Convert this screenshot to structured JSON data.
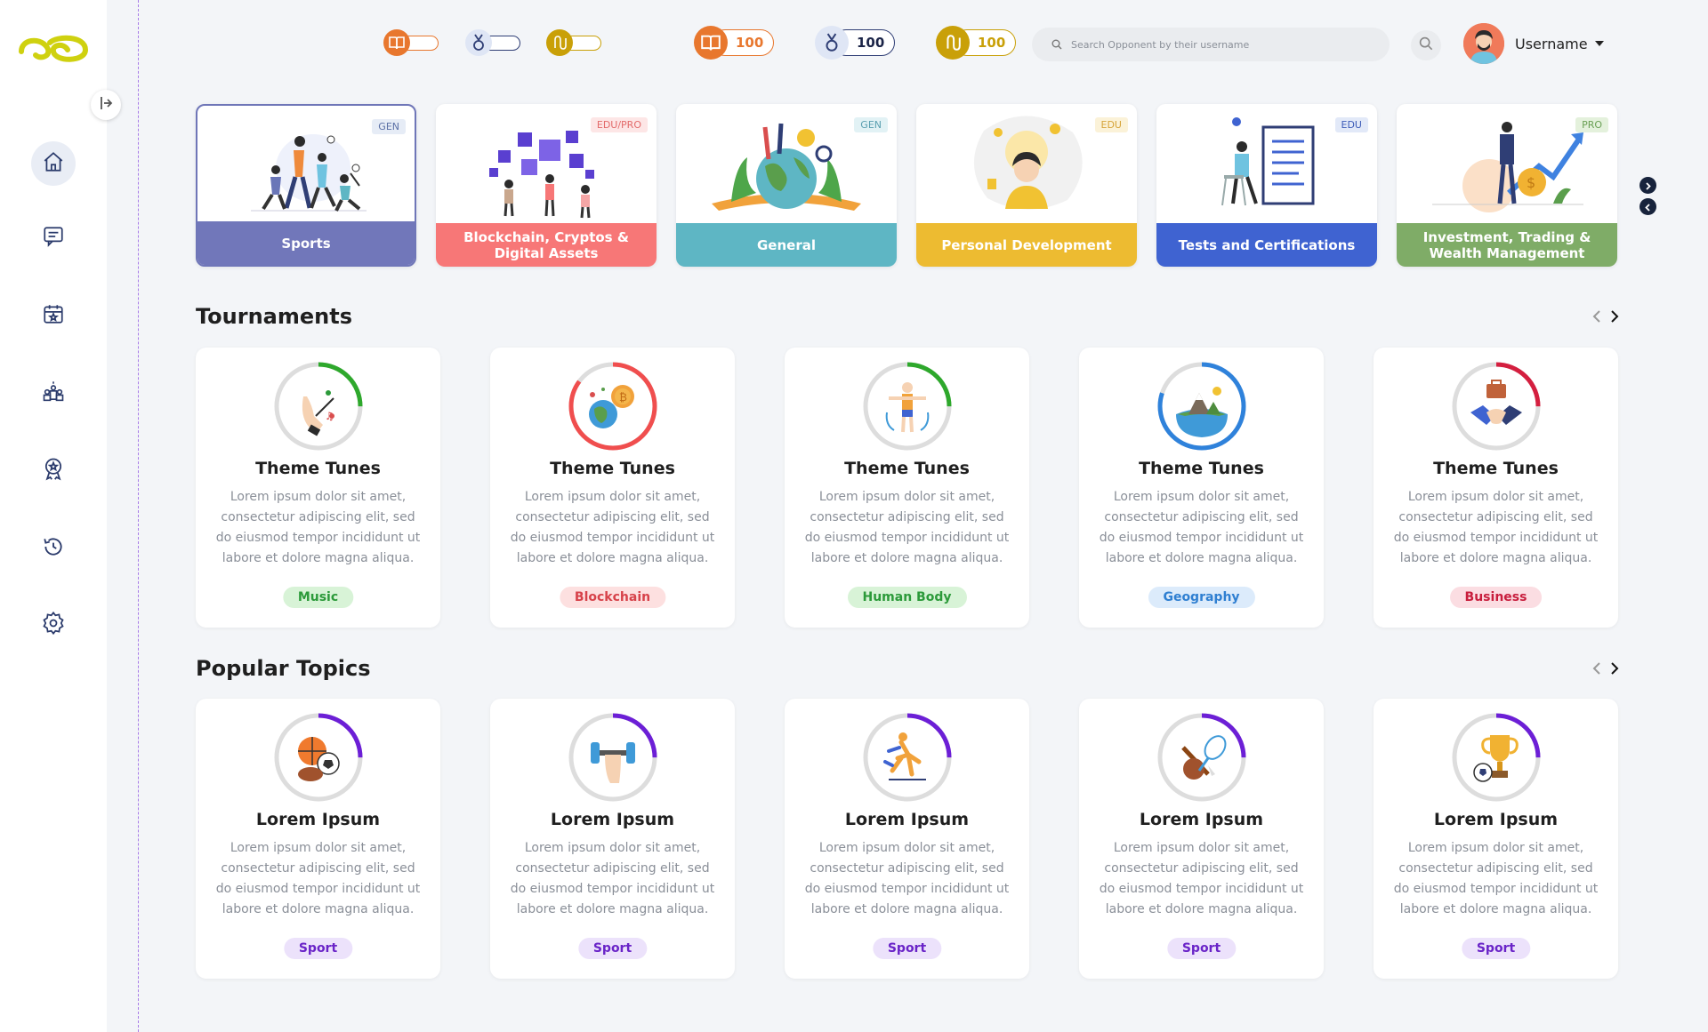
{
  "header": {
    "toggles": [
      {
        "icon": "book-icon",
        "color": "#e8772e"
      },
      {
        "icon": "medal-icon",
        "color": "#2f3e75"
      },
      {
        "icon": "coin-icon",
        "color": "#c9a008"
      }
    ],
    "counters": [
      {
        "icon": "book-icon",
        "value": "100",
        "color": "#e8772e"
      },
      {
        "icon": "medal-icon",
        "value": "100",
        "color": "#2f3e75"
      },
      {
        "icon": "coin-icon",
        "value": "100",
        "color": "#c9a008"
      }
    ],
    "search_placeholder": "Search Opponent by their username",
    "username": "Username"
  },
  "sidebar": {
    "items": [
      {
        "name": "home-icon",
        "active": true
      },
      {
        "name": "chat-icon",
        "active": false
      },
      {
        "name": "calendar-icon",
        "active": false
      },
      {
        "name": "team-icon",
        "active": false
      },
      {
        "name": "award-icon",
        "active": false
      },
      {
        "name": "history-icon",
        "active": false
      },
      {
        "name": "settings-icon",
        "active": false
      }
    ]
  },
  "categories": [
    {
      "label": "Sports",
      "tag": "GEN",
      "color": "#7177ba",
      "tag_color": "#5a6fa5",
      "tag_bg": "#e6ecf6"
    },
    {
      "label": "Blockchain, Cryptos & Digital Assets",
      "tag": "EDU/PRO",
      "color": "#f77777",
      "tag_color": "#e36b6b",
      "tag_bg": "#fde6e6"
    },
    {
      "label": "General",
      "tag": "GEN",
      "color": "#5eb6c4",
      "tag_color": "#5a9fb0",
      "tag_bg": "#e2f2f5"
    },
    {
      "label": "Personal Development",
      "tag": "EDU",
      "color": "#edbb31",
      "tag_color": "#d6a43a",
      "tag_bg": "#fbf2d8"
    },
    {
      "label": "Tests and Certifications",
      "tag": "EDU",
      "color": "#3f63d1",
      "tag_color": "#3d5cb8",
      "tag_bg": "#e2e9f8"
    },
    {
      "label": "Investment, Trading & Wealth Management",
      "tag": "PRO",
      "color": "#7fac67",
      "tag_color": "#6aa055",
      "tag_bg": "#e4f1dc"
    }
  ],
  "tournaments": {
    "title": "Tournaments",
    "cards": [
      {
        "title": "Theme Tunes",
        "desc": "Lorem ipsum dolor sit amet, consectetur adipiscing elit, sed do eiusmod tempor incididunt ut labore et dolore magna aliqua.",
        "badge": "Music",
        "badge_color": "#2c9a3a",
        "badge_bg": "#d8f3d7",
        "ring_color": "#2ea82c",
        "progress": 0.25,
        "icon": "music-hand-icon"
      },
      {
        "title": "Theme Tunes",
        "desc": "Lorem ipsum dolor sit amet, consectetur adipiscing elit, sed do eiusmod tempor incididunt ut labore et dolore magna aliqua.",
        "badge": "Blockchain",
        "badge_color": "#d7424a",
        "badge_bg": "#fde0e0",
        "ring_color": "#f04e4e",
        "progress": 0.85,
        "icon": "crypto-globe-icon"
      },
      {
        "title": "Theme Tunes",
        "desc": "Lorem ipsum dolor sit amet, consectetur adipiscing elit, sed do eiusmod tempor incididunt ut labore et dolore magna aliqua.",
        "badge": "Human Body",
        "badge_color": "#2c9a3a",
        "badge_bg": "#d8f3d7",
        "ring_color": "#2ea82c",
        "progress": 0.25,
        "icon": "human-body-icon"
      },
      {
        "title": "Theme Tunes",
        "desc": "Lorem ipsum dolor sit amet, consectetur adipiscing elit, sed do eiusmod tempor incididunt ut labore et dolore magna aliqua.",
        "badge": "Geography",
        "badge_color": "#2f7fd1",
        "badge_bg": "#dcebfb",
        "ring_color": "#2f82db",
        "progress": 0.8,
        "icon": "geography-icon"
      },
      {
        "title": "Theme Tunes",
        "desc": "Lorem ipsum dolor sit amet, consectetur adipiscing elit, sed do eiusmod tempor incididunt ut labore et dolore magna aliqua.",
        "badge": "Business",
        "badge_color": "#c81e3d",
        "badge_bg": "#fbdde2",
        "ring_color": "#d41f3f",
        "progress": 0.25,
        "icon": "handshake-icon"
      }
    ]
  },
  "popular": {
    "title": "Popular Topics",
    "cards": [
      {
        "title": "Lorem Ipsum",
        "desc": "Lorem ipsum dolor sit amet, consectetur adipiscing elit, sed do eiusmod tempor incididunt ut labore et dolore magna aliqua.",
        "badge": "Sport",
        "badge_color": "#6a24c8",
        "badge_bg": "#ece2fb",
        "ring_color": "#6c1fd6",
        "progress": 0.25,
        "icon": "balls-icon"
      },
      {
        "title": "Lorem Ipsum",
        "desc": "Lorem ipsum dolor sit amet, consectetur adipiscing elit, sed do eiusmod tempor incididunt ut labore et dolore magna aliqua.",
        "badge": "Sport",
        "badge_color": "#6a24c8",
        "badge_bg": "#ece2fb",
        "ring_color": "#6c1fd6",
        "progress": 0.25,
        "icon": "dumbbell-icon"
      },
      {
        "title": "Lorem Ipsum",
        "desc": "Lorem ipsum dolor sit amet, consectetur adipiscing elit, sed do eiusmod tempor incididunt ut labore et dolore magna aliqua.",
        "badge": "Sport",
        "badge_color": "#6a24c8",
        "badge_bg": "#ece2fb",
        "ring_color": "#6c1fd6",
        "progress": 0.25,
        "icon": "runner-icon"
      },
      {
        "title": "Lorem Ipsum",
        "desc": "Lorem ipsum dolor sit amet, consectetur adipiscing elit, sed do eiusmod tempor incididunt ut labore et dolore magna aliqua.",
        "badge": "Sport",
        "badge_color": "#6a24c8",
        "badge_bg": "#ece2fb",
        "ring_color": "#6c1fd6",
        "progress": 0.25,
        "icon": "racket-icon"
      },
      {
        "title": "Lorem Ipsum",
        "desc": "Lorem ipsum dolor sit amet, consectetur adipiscing elit, sed do eiusmod tempor incididunt ut labore et dolore magna aliqua.",
        "badge": "Sport",
        "badge_color": "#6a24c8",
        "badge_bg": "#ece2fb",
        "ring_color": "#6c1fd6",
        "progress": 0.25,
        "icon": "trophy-icon"
      }
    ]
  }
}
